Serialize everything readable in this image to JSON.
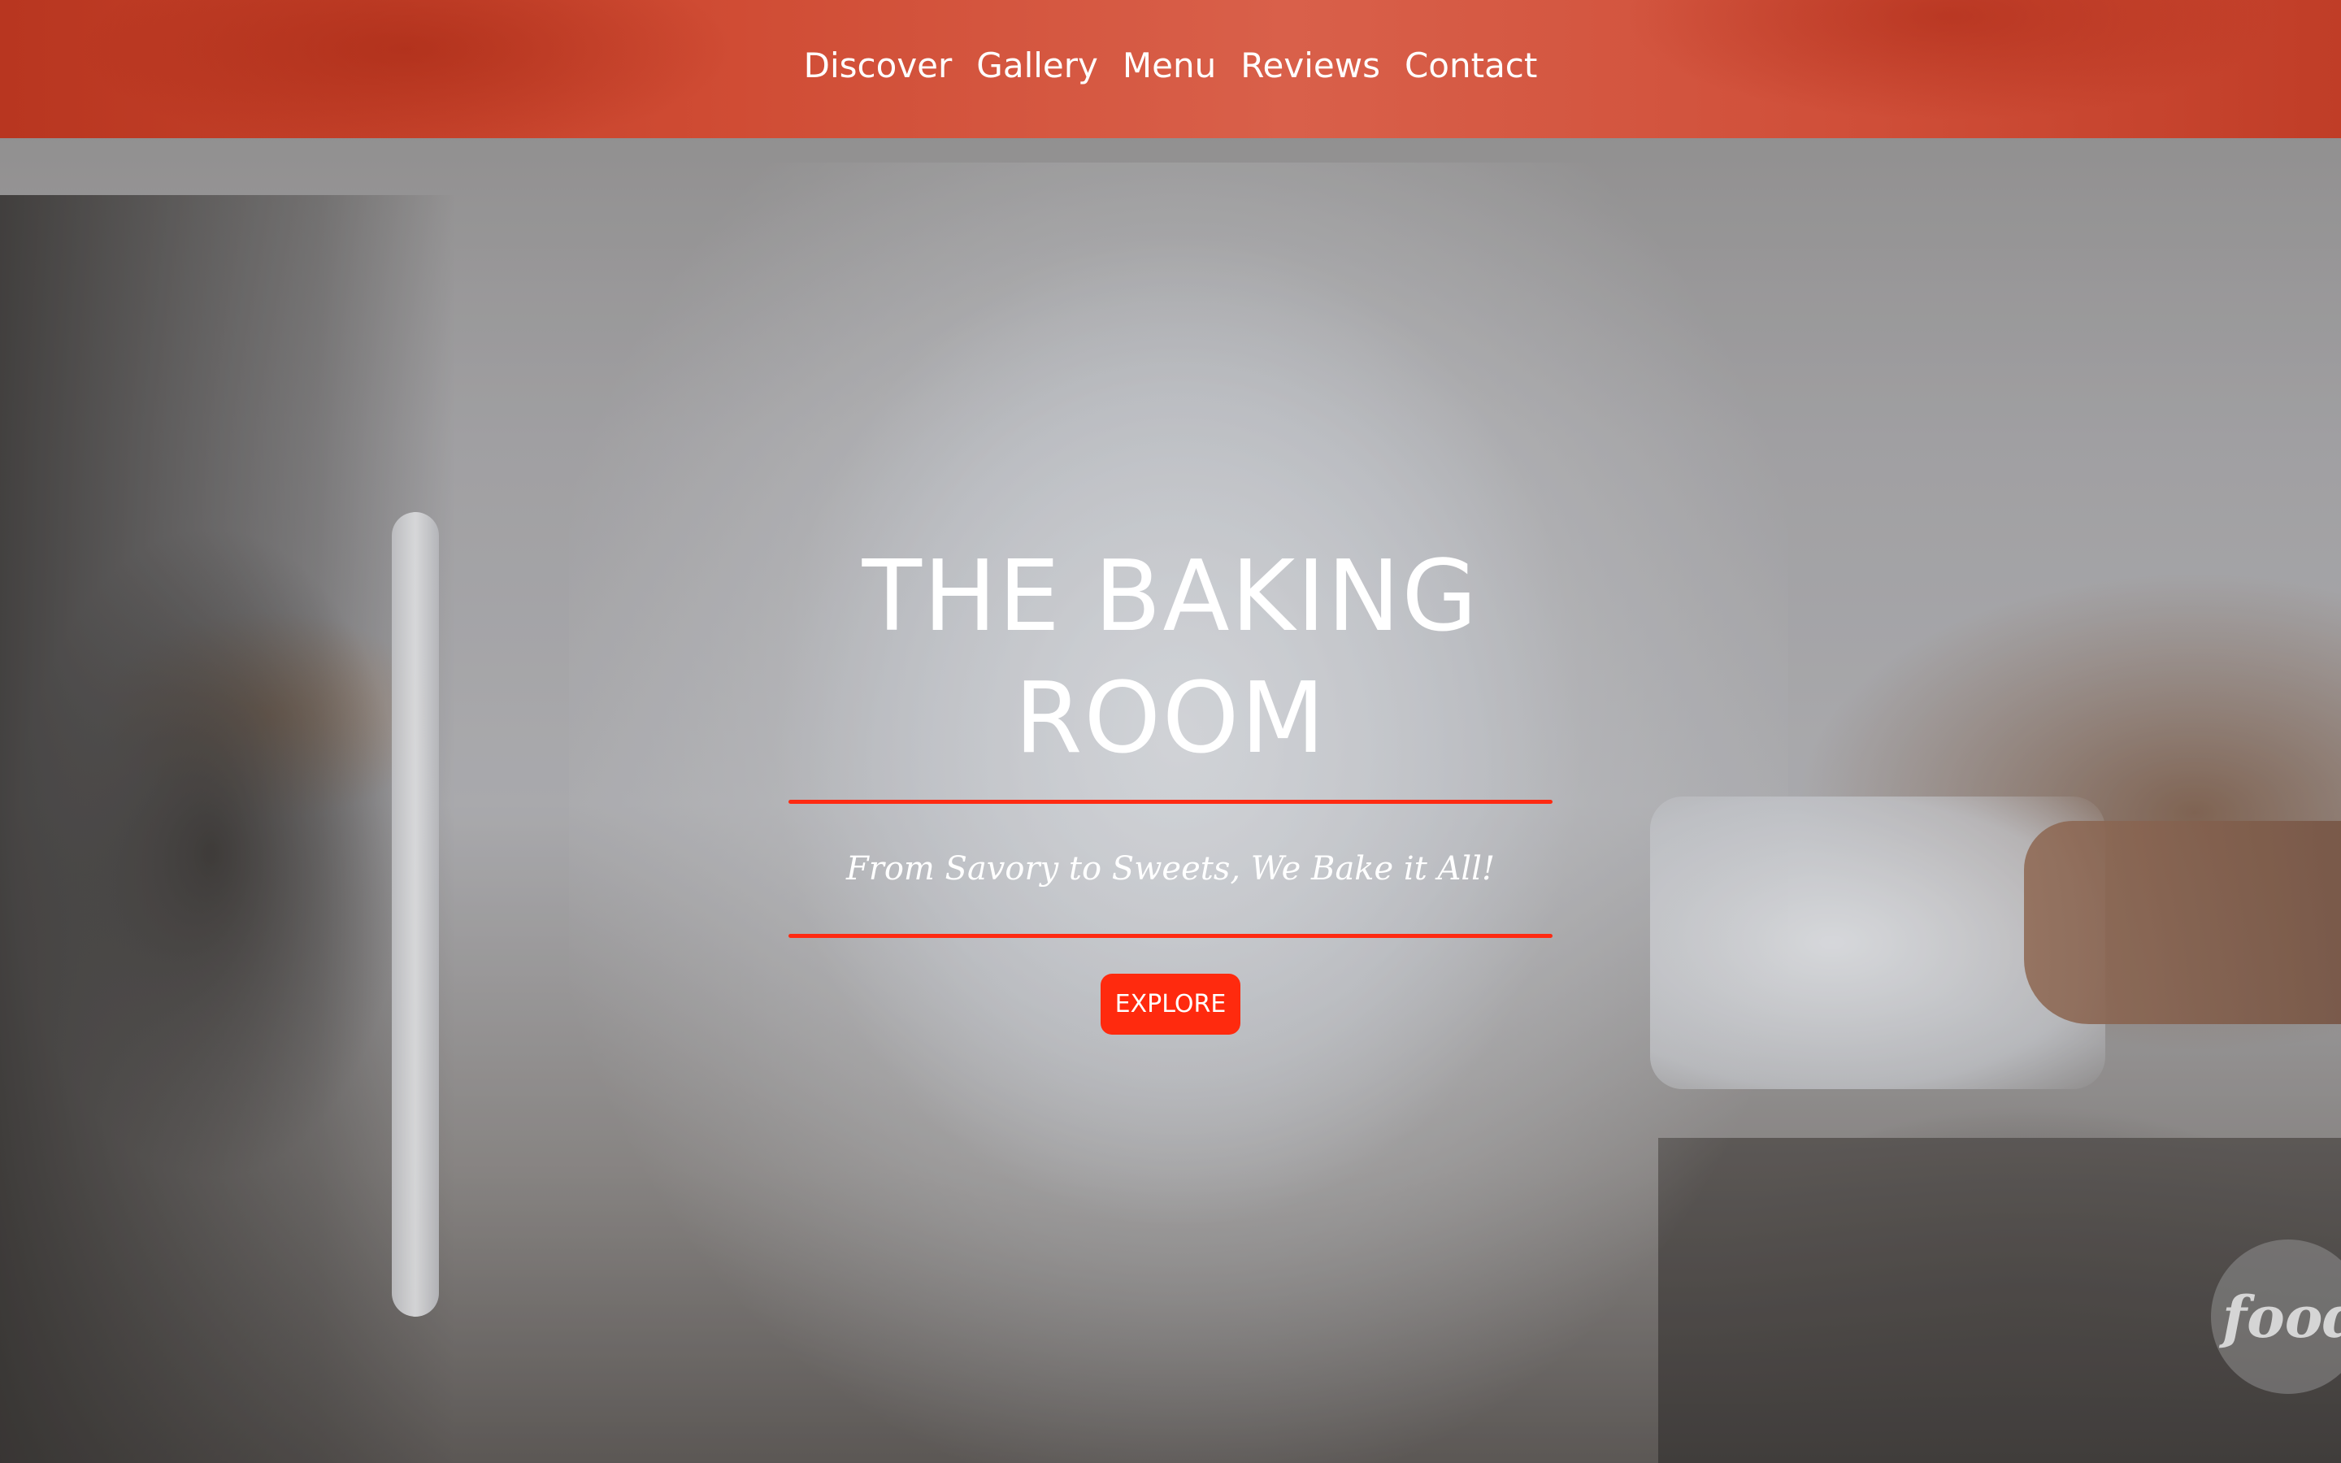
{
  "nav": {
    "items": [
      {
        "label": "Discover"
      },
      {
        "label": "Gallery"
      },
      {
        "label": "Menu"
      },
      {
        "label": "Reviews"
      },
      {
        "label": "Contact"
      }
    ]
  },
  "hero": {
    "title": "THE BAKING ROOM",
    "subtitle": "From Savory to Sweets, We Bake it All!",
    "button_label": "EXPLORE"
  },
  "watermark": {
    "text": "food"
  },
  "colors": {
    "accent": "#ff2a0e",
    "nav_bar": "#d9604a",
    "text": "#ffffff"
  }
}
